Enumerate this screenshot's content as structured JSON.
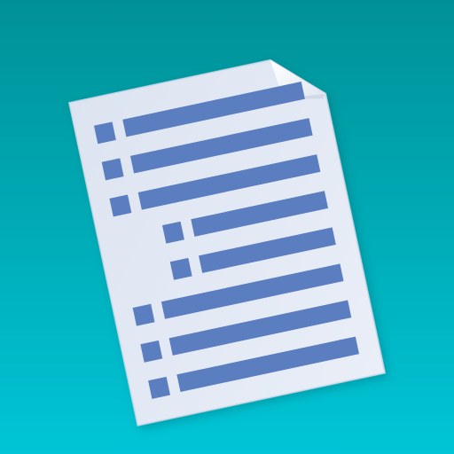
{
  "app_icon": {
    "name": "outline-document-app-icon",
    "icon": "outline-list-document-icon",
    "colors": {
      "background_top": "#009197",
      "background_bottom": "#00c5d6",
      "paper": "#e4eaf5",
      "paper_edge": "#ced7e6",
      "fold": "#f7f9fc",
      "fold_shadow": "#c4cddc",
      "bar": "#5a7ec0"
    },
    "outline": {
      "rows": [
        {
          "level": 0
        },
        {
          "level": 0
        },
        {
          "level": 0
        },
        {
          "level": 1
        },
        {
          "level": 1
        },
        {
          "level": 0
        },
        {
          "level": 0
        },
        {
          "level": 0
        }
      ]
    }
  }
}
